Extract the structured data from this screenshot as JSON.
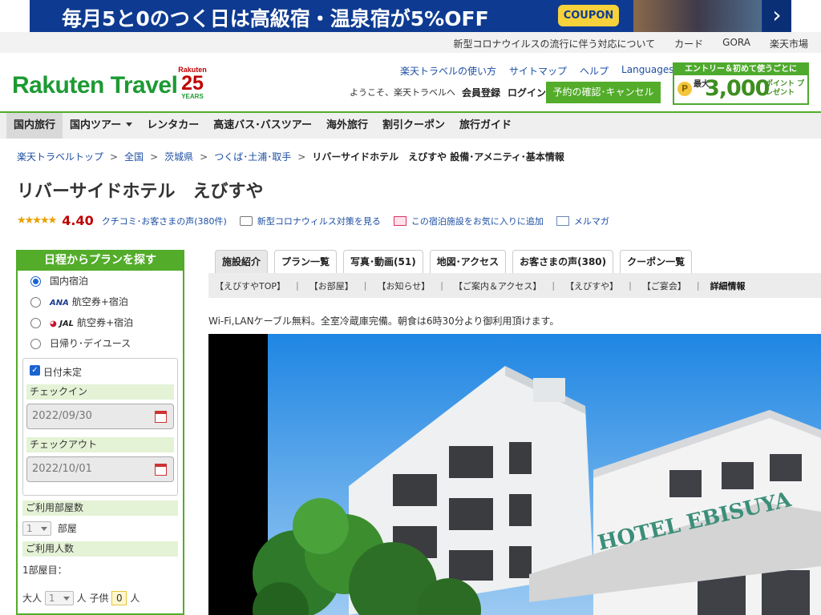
{
  "banner": {
    "text": "毎月5と0のつく日は高級宿・温泉宿が5%OFF",
    "coupon": "COUPON"
  },
  "top_links": [
    "新型コロナウイルスの流行に伴う対応について",
    "カード",
    "GORA",
    "楽天市場"
  ],
  "header": {
    "logo": "Rakuten Travel",
    "badge_brand": "Rakuten",
    "badge_number": "25",
    "badge_years": "YEARS",
    "links": [
      "楽天トラベルの使い方",
      "サイトマップ",
      "ヘルプ"
    ],
    "languages": "Languages",
    "welcome": "ようこそ、楽天トラベルへ",
    "register": "会員登録",
    "login": "ログイン",
    "confirm_button": "予約の確認･キャンセル",
    "promo_header": "エントリー＆初めて使うごとに",
    "promo_prefix": "最大",
    "promo_amount": "3,000",
    "promo_suffix": "ポイント プレゼント"
  },
  "nav": [
    "国内旅行",
    "国内ツアー",
    "レンタカー",
    "高速バス･バスツアー",
    "海外旅行",
    "割引クーポン",
    "旅行ガイド"
  ],
  "breadcrumb": [
    "楽天トラベルトップ",
    "全国",
    "茨城県",
    "つくば･土浦･取手"
  ],
  "breadcrumb_current": "リバーサイドホテル　えびすや 設備･アメニティ･基本情報",
  "hotel": {
    "name": "リバーサイドホテル　えびすや",
    "stars": "★★★★★",
    "score": "4.40",
    "reviews": "クチコミ･お客さまの声(380件)",
    "covid_link": "新型コロナウィルス対策を見る",
    "fav_link": "この宿泊施設をお気に入りに追加",
    "mail_link": "メルマガ",
    "description": "Wi-Fi,LANケーブル無料。全室冷蔵庫完備。朝食は6時30分より御利用頂けます。"
  },
  "sidebar": {
    "header": "日程からプランを探す",
    "options": [
      {
        "label": "国内宿泊",
        "selected": true
      },
      {
        "brand": "ANA",
        "label": "航空券+宿泊",
        "selected": false
      },
      {
        "brand": "JAL",
        "label": "航空券+宿泊",
        "selected": false
      },
      {
        "label": "日帰り･デイユース",
        "selected": false
      }
    ],
    "undecided": "日付未定",
    "checkin_label": "チェックイン",
    "checkin": "2022/09/30",
    "checkout_label": "チェックアウト",
    "checkout": "2022/10/01",
    "rooms_label": "ご利用部屋数",
    "rooms_value": "1",
    "rooms_unit": "部屋",
    "people_label": "ご利用人数",
    "room1": "1部屋目：",
    "adult_label": "大人",
    "adult_value": "1",
    "person_unit": "人",
    "child_label": "子供",
    "child_value": "0"
  },
  "tabs": [
    "施設紹介",
    "プラン一覧",
    "写真･動画(51)",
    "地図･アクセス",
    "お客さまの声(380)",
    "クーポン一覧"
  ],
  "subnav": [
    "【えびすやTOP】",
    "【お部屋】",
    "【お知らせ】",
    "【ご案内＆アクセス】",
    "【えびすや】",
    "【ご宴会】",
    "詳細情報"
  ],
  "photo": {
    "sign": "HOTEL EBISUYA"
  },
  "colors": {
    "green": "#53ac2a",
    "banner": "#0e3b91",
    "score": "#bf0000"
  }
}
